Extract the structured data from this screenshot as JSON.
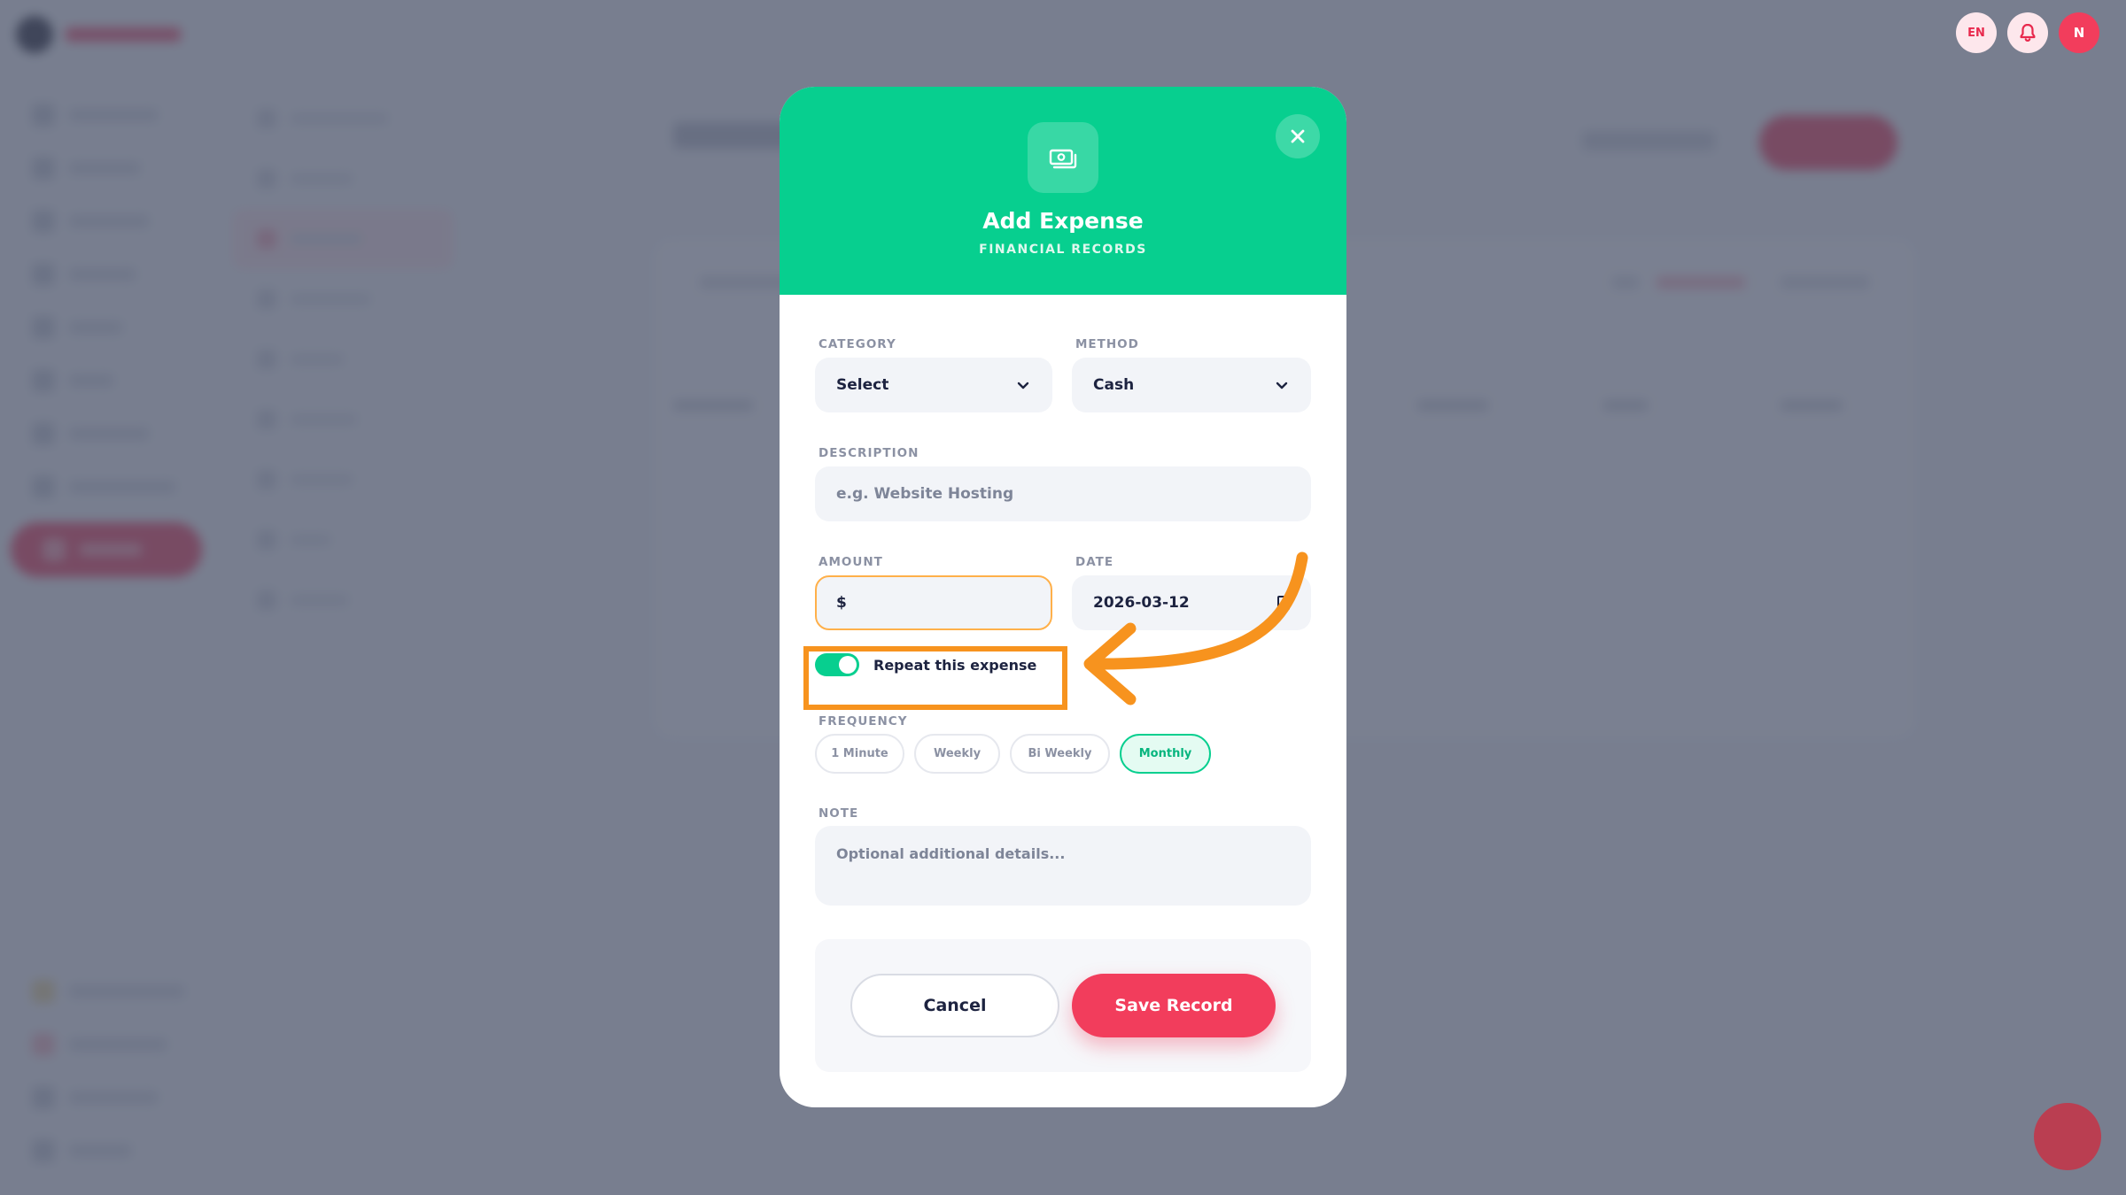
{
  "header": {
    "lang_label": "EN",
    "avatar_initial": "N"
  },
  "modal": {
    "title": "Add Expense",
    "subtitle": "FINANCIAL RECORDS",
    "category": {
      "label": "CATEGORY",
      "value": "Select"
    },
    "method": {
      "label": "METHOD",
      "value": "Cash"
    },
    "description": {
      "label": "DESCRIPTION",
      "placeholder": "e.g. Website Hosting"
    },
    "amount": {
      "label": "AMOUNT",
      "prefix": "$",
      "value": ""
    },
    "date": {
      "label": "DATE",
      "value": "2026-03-12"
    },
    "repeat": {
      "label": "Repeat this expense",
      "enabled": true
    },
    "frequency": {
      "label": "FREQUENCY",
      "options": [
        "1 Minute",
        "Weekly",
        "Bi Weekly",
        "Monthly"
      ],
      "selected": "Monthly"
    },
    "note": {
      "label": "NOTE",
      "placeholder": "Optional additional details..."
    },
    "cancel_label": "Cancel",
    "save_label": "Save Record"
  },
  "colors": {
    "accent_green": "#07cf8f",
    "accent_red": "#f23d5c",
    "annotation_orange": "#f7931e"
  },
  "icons": [
    "money-icon",
    "close-icon",
    "bell-icon",
    "chevron-down-icon",
    "calendar-icon"
  ]
}
